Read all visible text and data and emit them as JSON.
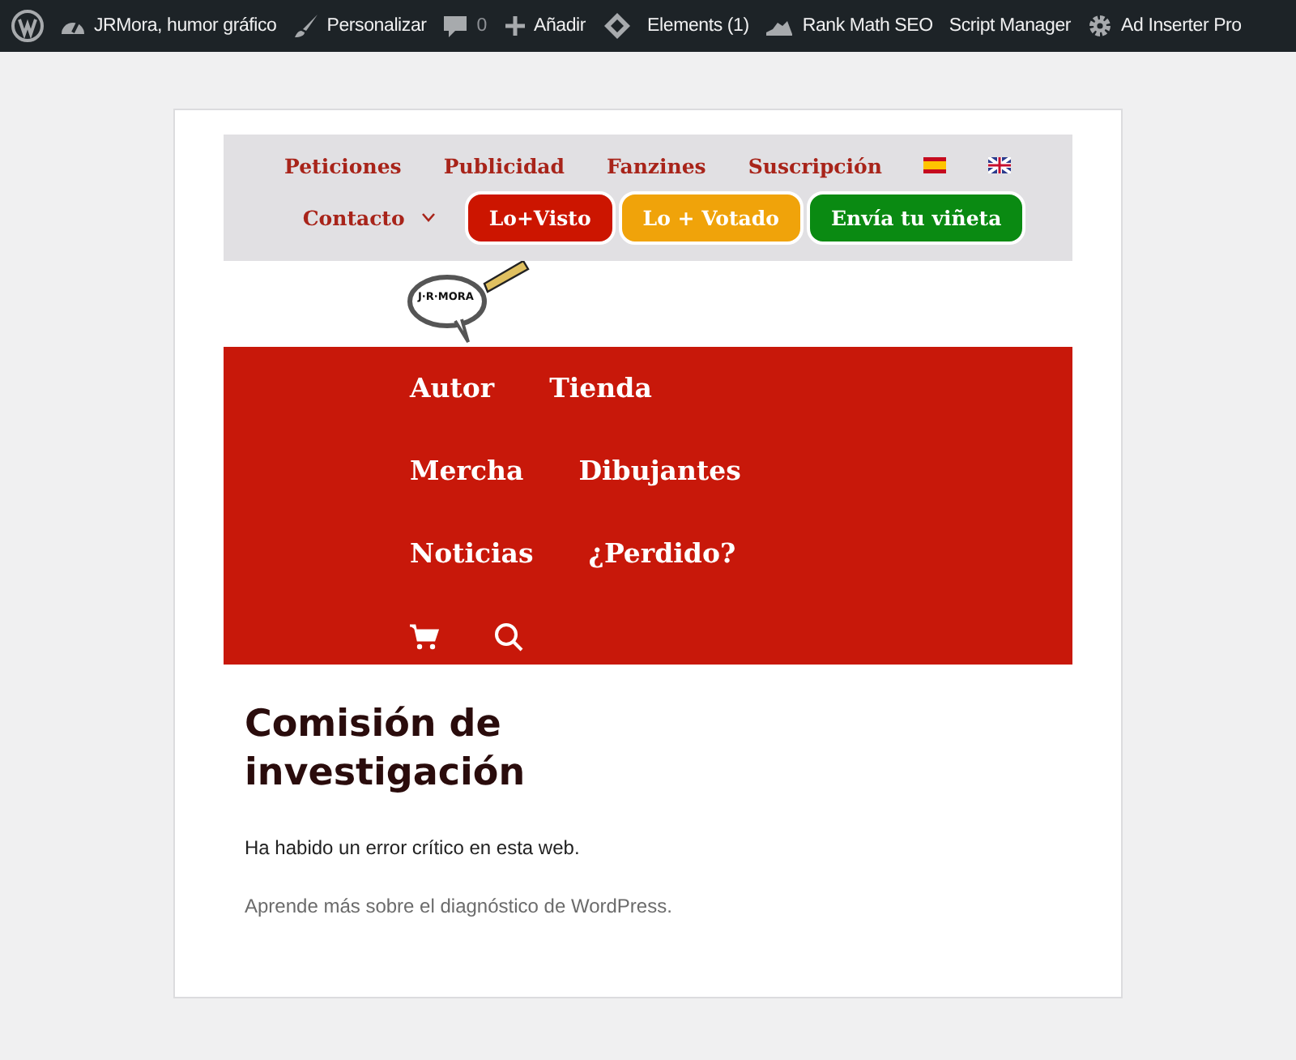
{
  "admin_bar": {
    "items": [
      {
        "kind": "wp"
      },
      {
        "kind": "dashboard",
        "label": "JRMora, humor gráfico"
      },
      {
        "kind": "brush",
        "label": "Personalizar"
      },
      {
        "kind": "comment",
        "label": "0"
      },
      {
        "kind": "plus",
        "label": "Añadir"
      },
      {
        "kind": "diamond"
      },
      {
        "kind": "text",
        "label": "Elements (1)"
      },
      {
        "kind": "chart",
        "label": "Rank Math SEO"
      },
      {
        "kind": "text",
        "label": "Script Manager"
      },
      {
        "kind": "gear",
        "label": "Ad Inserter Pro"
      }
    ]
  },
  "top_nav": {
    "links": [
      {
        "kind": "link",
        "label": "Peticiones"
      },
      {
        "kind": "link",
        "label": "Publicidad"
      },
      {
        "kind": "link",
        "label": "Fanzines"
      },
      {
        "kind": "link",
        "label": "Suscripción"
      },
      {
        "kind": "flag-es"
      },
      {
        "kind": "flag-uk"
      }
    ],
    "contact": {
      "label": "Contacto"
    },
    "buttons": [
      {
        "label": "Lo+Visto",
        "color": "#cc1500"
      },
      {
        "label": "Lo + Votado",
        "color": "#f0a30a"
      },
      {
        "label": "Envía tu viñeta",
        "color": "#0a8a12"
      }
    ]
  },
  "logo": {
    "text": "J·R·MORA"
  },
  "main_menu": {
    "rows": [
      [
        {
          "kind": "link",
          "label": "Autor"
        },
        {
          "kind": "link",
          "label": "Tienda"
        }
      ],
      [
        {
          "kind": "link",
          "label": "Mercha"
        },
        {
          "kind": "link",
          "label": "Dibujantes"
        }
      ],
      [
        {
          "kind": "link",
          "label": "Noticias"
        },
        {
          "kind": "link",
          "label": "¿Perdido?"
        }
      ],
      [
        {
          "kind": "cart"
        },
        {
          "kind": "search"
        }
      ]
    ]
  },
  "content": {
    "title": "Comisión de investigación",
    "message": "Ha habido un error crítico en esta web.",
    "link": "Aprende más sobre el diagnóstico de WordPress."
  }
}
